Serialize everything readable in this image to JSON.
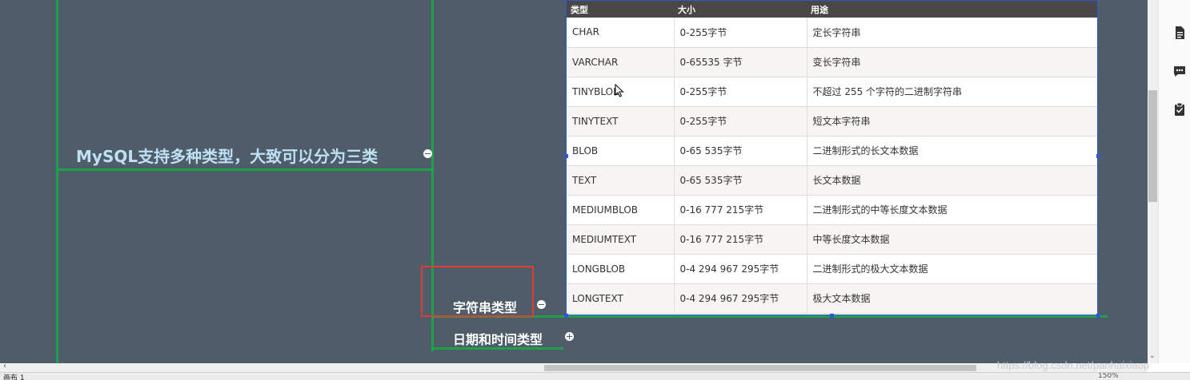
{
  "mindmap": {
    "main_topic": "MySQL支持多种类型，大致可以分为三类",
    "string_type_topic": "字符串类型",
    "datetime_type_topic": "日期和时间类型"
  },
  "table": {
    "headers": [
      "类型",
      "大小",
      "用途"
    ],
    "rows": [
      [
        "CHAR",
        "0-255字节",
        "定长字符串"
      ],
      [
        "VARCHAR",
        "0-65535 字节",
        "变长字符串"
      ],
      [
        "TINYBLOB",
        "0-255字节",
        "不超过 255 个字符的二进制字符串"
      ],
      [
        "TINYTEXT",
        "0-255字节",
        "短文本字符串"
      ],
      [
        "BLOB",
        "0-65 535字节",
        "二进制形式的长文本数据"
      ],
      [
        "TEXT",
        "0-65 535字节",
        "长文本数据"
      ],
      [
        "MEDIUMBLOB",
        "0-16 777 215字节",
        "二进制形式的中等长度文本数据"
      ],
      [
        "MEDIUMTEXT",
        "0-16 777 215字节",
        "中等长度文本数据"
      ],
      [
        "LONGBLOB",
        "0-4 294 967 295字节",
        "二进制形式的极大文本数据"
      ],
      [
        "LONGTEXT",
        "0-4 294 967 295字节",
        "极大文本数据"
      ]
    ]
  },
  "right_panel": {
    "icons": [
      "document-icon",
      "comment-icon",
      "clipboard-check-icon"
    ]
  },
  "status_bar": {
    "sheet_tab": "画布 1",
    "zoom": "150%"
  },
  "watermark": "https://blog.csdn.net/panhaixiaop",
  "colors": {
    "canvas_bg": "#4f5c6a",
    "branch_line": "#1fa04b",
    "highlight_box": "#e53a32",
    "table_header_bg": "#4a4846",
    "selection": "#2f56d6"
  }
}
